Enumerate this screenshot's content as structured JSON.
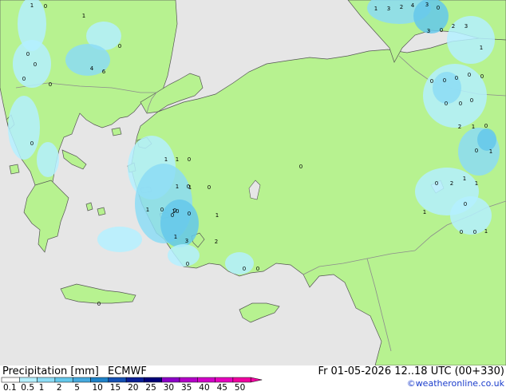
{
  "map": {
    "colors": {
      "sea": "#e6e6e6",
      "land": "#b7f290",
      "coast": "#555555",
      "border": "#8c8c8c",
      "label_text": "#000000"
    },
    "cell_labels": [
      "1",
      "0",
      "1",
      "0",
      "0",
      "0",
      "4",
      "6",
      "0",
      "0",
      "0",
      "1",
      "3",
      "2",
      "4",
      "3",
      "0",
      "3",
      "0",
      "2",
      "3",
      "1",
      "0",
      "0",
      "0",
      "0",
      "0",
      "0",
      "0",
      "0",
      "2",
      "1",
      "0",
      "0",
      "1",
      "1",
      "1",
      "0",
      "1",
      "1",
      "1",
      "0",
      "0",
      "0",
      "0",
      "1",
      "0",
      "0",
      "1",
      "0",
      "2",
      "1",
      "1",
      "0",
      "10",
      "0",
      "0",
      "1",
      "2",
      "3",
      "1",
      "0",
      "0",
      "0",
      "0",
      "0"
    ]
  },
  "legend": {
    "title": "Precipitation [mm]",
    "model": "ECMWF",
    "scale_labels": [
      "0.1",
      "0.5",
      "1",
      "2",
      "5",
      "10",
      "15",
      "20",
      "25",
      "30",
      "35",
      "40",
      "45",
      "50"
    ],
    "scale_colors": [
      "#ffffff",
      "#b4f0ff",
      "#8cdcf5",
      "#64c8eb",
      "#46aade",
      "#1e82c8",
      "#1450b4",
      "#0a1e96",
      "#000078",
      "#8c00c8",
      "#b400c8",
      "#d200c8",
      "#e600be",
      "#f000a0"
    ]
  },
  "valid_time": "Fr 01-05-2026 12..18 UTC (00+330)",
  "credit": "©weatheronline.co.uk"
}
